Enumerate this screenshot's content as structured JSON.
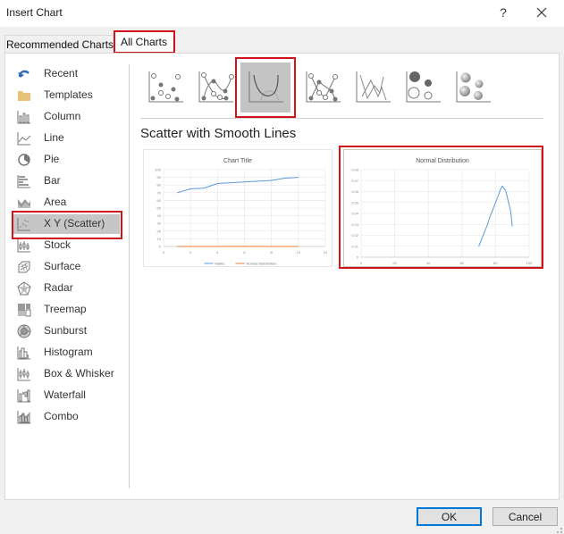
{
  "window": {
    "title": "Insert Chart",
    "help_label": "?",
    "close_label": "✕"
  },
  "tabs": [
    {
      "label": "Recommended Charts",
      "active": false
    },
    {
      "label": "All Charts",
      "active": true
    }
  ],
  "sidebar": {
    "items": [
      {
        "label": "Recent",
        "icon": "recent-icon"
      },
      {
        "label": "Templates",
        "icon": "folder-icon"
      },
      {
        "label": "Column",
        "icon": "column-chart-icon"
      },
      {
        "label": "Line",
        "icon": "line-chart-icon"
      },
      {
        "label": "Pie",
        "icon": "pie-chart-icon"
      },
      {
        "label": "Bar",
        "icon": "bar-chart-icon"
      },
      {
        "label": "Area",
        "icon": "area-chart-icon"
      },
      {
        "label": "X Y (Scatter)",
        "icon": "scatter-chart-icon",
        "selected": true
      },
      {
        "label": "Stock",
        "icon": "stock-chart-icon"
      },
      {
        "label": "Surface",
        "icon": "surface-chart-icon"
      },
      {
        "label": "Radar",
        "icon": "radar-chart-icon"
      },
      {
        "label": "Treemap",
        "icon": "treemap-chart-icon"
      },
      {
        "label": "Sunburst",
        "icon": "sunburst-chart-icon"
      },
      {
        "label": "Histogram",
        "icon": "histogram-chart-icon"
      },
      {
        "label": "Box & Whisker",
        "icon": "box-whisker-chart-icon"
      },
      {
        "label": "Waterfall",
        "icon": "waterfall-chart-icon"
      },
      {
        "label": "Combo",
        "icon": "combo-chart-icon"
      }
    ]
  },
  "subtypes": [
    {
      "name": "Scatter",
      "icon": "scatter-markers-icon"
    },
    {
      "name": "Scatter with Smooth Lines and Markers",
      "icon": "scatter-smooth-markers-icon"
    },
    {
      "name": "Scatter with Smooth Lines",
      "icon": "scatter-smooth-lines-icon",
      "selected": true
    },
    {
      "name": "Scatter with Straight Lines and Markers",
      "icon": "scatter-straight-markers-icon"
    },
    {
      "name": "Scatter with Straight Lines",
      "icon": "scatter-straight-lines-icon"
    },
    {
      "name": "Bubble",
      "icon": "bubble-icon"
    },
    {
      "name": "3-D Bubble",
      "icon": "bubble-3d-icon"
    }
  ],
  "selected_subtype_title": "Scatter with Smooth Lines",
  "chart_data": [
    {
      "type": "line",
      "title": "Chart Title",
      "xlabel": "",
      "ylabel": "",
      "xlim": [
        0,
        12
      ],
      "ylim": [
        0,
        100
      ],
      "xticks": [
        0,
        2,
        4,
        6,
        8,
        10,
        12
      ],
      "yticks": [
        0,
        10,
        20,
        30,
        40,
        50,
        60,
        70,
        80,
        90,
        100
      ],
      "grid": true,
      "legend": "bottom",
      "series": [
        {
          "name": "Marks",
          "color": "#5b9bd5",
          "x": [
            1,
            2,
            3,
            4,
            5,
            6,
            7,
            8,
            9,
            10
          ],
          "values": [
            70,
            75,
            76,
            82,
            83,
            84,
            85,
            86,
            89,
            90
          ]
        },
        {
          "name": "Normal Distribution",
          "color": "#ed7d31",
          "x": [
            1,
            2,
            3,
            4,
            5,
            6,
            7,
            8,
            9,
            10
          ],
          "values": [
            0.01,
            0.02,
            0.03,
            0.05,
            0.06,
            0.065,
            0.06,
            0.05,
            0.03,
            0.028
          ]
        }
      ]
    },
    {
      "type": "line",
      "title": "Normal Distribution",
      "xlabel": "",
      "ylabel": "",
      "xlim": [
        0,
        100
      ],
      "ylim": [
        0,
        0.08
      ],
      "xticks": [
        0,
        20,
        40,
        60,
        80,
        100
      ],
      "yticks": [
        0,
        0.01,
        0.02,
        0.03,
        0.04,
        0.05,
        0.06,
        0.07,
        0.08
      ],
      "grid": true,
      "legend": "none",
      "series": [
        {
          "name": "Normal Distribution",
          "color": "#5b9bd5",
          "x": [
            70,
            75,
            76,
            80,
            82,
            83,
            84,
            86,
            89,
            90
          ],
          "values": [
            0.01,
            0.029,
            0.034,
            0.05,
            0.058,
            0.062,
            0.065,
            0.061,
            0.042,
            0.028
          ]
        }
      ]
    }
  ],
  "buttons": {
    "ok": "OK",
    "cancel": "Cancel"
  },
  "colors": {
    "highlight": "#d0121b",
    "accent": "#0078d7",
    "series_blue": "#5b9bd5",
    "series_orange": "#ed7d31"
  }
}
